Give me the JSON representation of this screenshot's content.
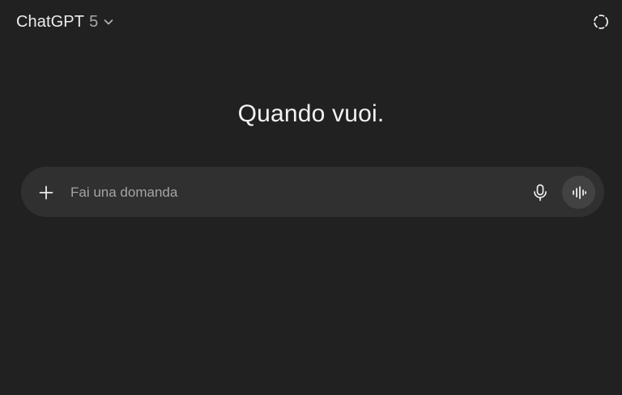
{
  "header": {
    "model_name": "ChatGPT",
    "model_version": "5",
    "chevron_icon": "chevron-down-icon",
    "temporary_chat_icon": "dashed-circle-icon"
  },
  "main": {
    "headline": "Quando vuoi."
  },
  "composer": {
    "placeholder": "Fai una domanda",
    "value": "",
    "add_icon": "plus-icon",
    "mic_icon": "microphone-icon",
    "voice_icon": "waveform-icon"
  },
  "colors": {
    "background": "#212121",
    "composer_background": "#303030",
    "voice_button_background": "#424242",
    "text_primary": "#ececec",
    "text_secondary": "#a4a4a4"
  }
}
